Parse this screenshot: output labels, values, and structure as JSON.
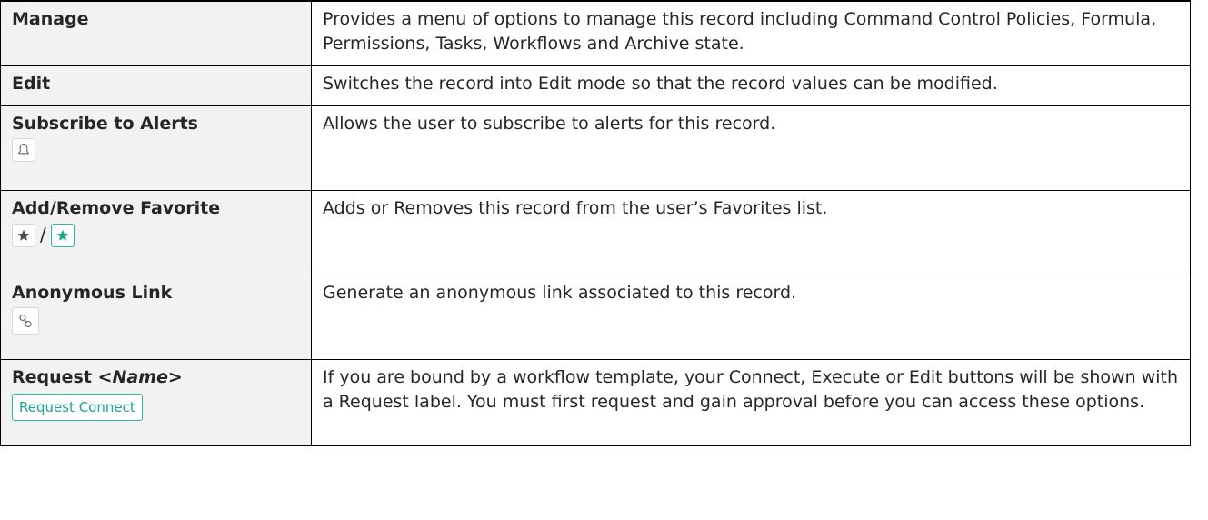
{
  "rows": [
    {
      "label": "Manage",
      "description": "Provides a menu of options to manage this record including Command Control Policies, Formula, Permissions, Tasks, Workflows and Archive state."
    },
    {
      "label": "Edit",
      "description": "Switches the record into Edit mode so that the record values can be modified."
    },
    {
      "label": "Subscribe to Alerts",
      "description": "Allows the user to subscribe to alerts for this record.",
      "icon": "bell-icon"
    },
    {
      "label": "Add/Remove Favorite",
      "description": "Adds or Removes this record from the user’s Favorites list.",
      "icons": [
        "star-icon",
        "star-active-icon"
      ],
      "separator": "/"
    },
    {
      "label": "Anonymous Link",
      "description": "Generate an anonymous link associated to this record.",
      "icon": "link-icon"
    },
    {
      "label_prefix": "Request ",
      "label_name": "<Name>",
      "description": "If you are bound by a workflow template, your Connect, Execute or Edit buttons will be shown with a Request label.  You must first request and gain approval before you can access these options.",
      "button_label": "Request Connect"
    }
  ],
  "colors": {
    "accent": "#2bb89a",
    "label_bg": "#f2f2f2",
    "border": "#000000",
    "icon_gray": "#555555"
  }
}
